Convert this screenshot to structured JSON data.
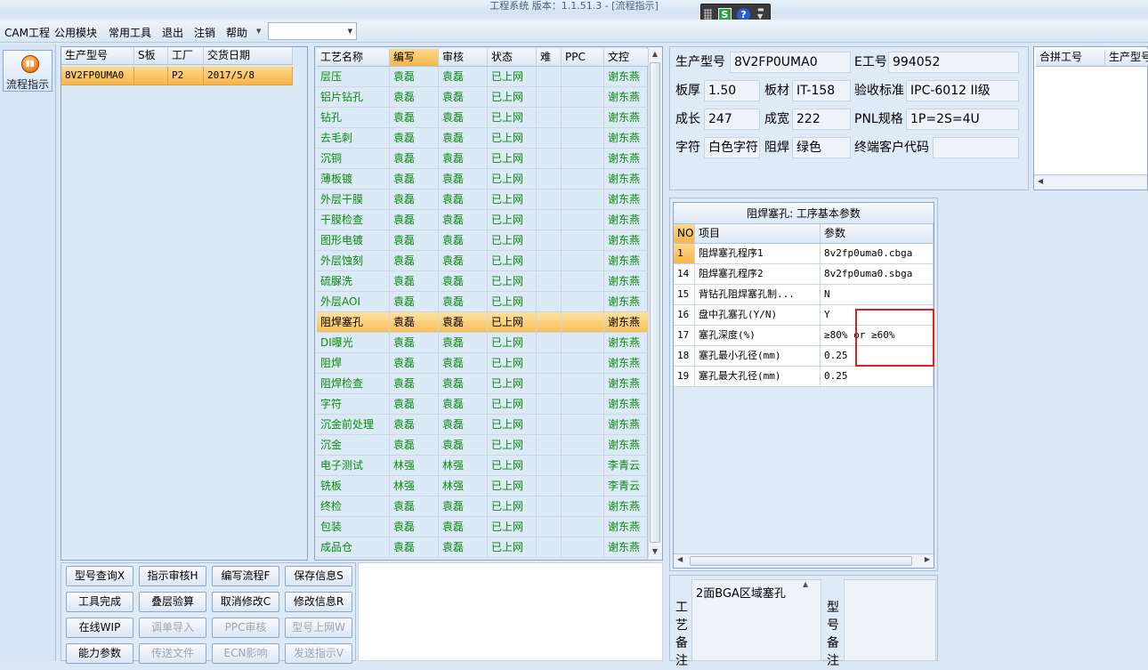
{
  "window": {
    "title": "工程系统   版本：1.1.51.3 - [流程指示]"
  },
  "menu": {
    "items": [
      "CAM工程",
      "公用模块",
      "常用工具",
      "退出",
      "注销",
      "帮助"
    ]
  },
  "left_strip": {
    "flow_button": "流程指示"
  },
  "order_grid": {
    "headers": [
      "生产型号",
      "S板",
      "工厂",
      "交货日期"
    ],
    "row": [
      "8V2FP0UMA0",
      "",
      "P2",
      "2017/5/8"
    ]
  },
  "process_grid": {
    "headers": [
      "工艺名称",
      "编写",
      "审核",
      "状态",
      "难",
      "PPC",
      "文控"
    ],
    "rows": [
      [
        "层压",
        "袁磊",
        "袁磊",
        "已上网",
        "",
        "",
        "谢东燕"
      ],
      [
        "铝片钻孔",
        "袁磊",
        "袁磊",
        "已上网",
        "",
        "",
        "谢东燕"
      ],
      [
        "钻孔",
        "袁磊",
        "袁磊",
        "已上网",
        "",
        "",
        "谢东燕"
      ],
      [
        "去毛刺",
        "袁磊",
        "袁磊",
        "已上网",
        "",
        "",
        "谢东燕"
      ],
      [
        "沉铜",
        "袁磊",
        "袁磊",
        "已上网",
        "",
        "",
        "谢东燕"
      ],
      [
        "薄板镀",
        "袁磊",
        "袁磊",
        "已上网",
        "",
        "",
        "谢东燕"
      ],
      [
        "外层干膜",
        "袁磊",
        "袁磊",
        "已上网",
        "",
        "",
        "谢东燕"
      ],
      [
        "干膜检查",
        "袁磊",
        "袁磊",
        "已上网",
        "",
        "",
        "谢东燕"
      ],
      [
        "图形电镀",
        "袁磊",
        "袁磊",
        "已上网",
        "",
        "",
        "谢东燕"
      ],
      [
        "外层蚀刻",
        "袁磊",
        "袁磊",
        "已上网",
        "",
        "",
        "谢东燕"
      ],
      [
        "硫脲洗",
        "袁磊",
        "袁磊",
        "已上网",
        "",
        "",
        "谢东燕"
      ],
      [
        "外层AOI",
        "袁磊",
        "袁磊",
        "已上网",
        "",
        "",
        "谢东燕"
      ],
      [
        "阻焊塞孔",
        "袁磊",
        "袁磊",
        "已上网",
        "",
        "",
        "谢东燕"
      ],
      [
        "DI曝光",
        "袁磊",
        "袁磊",
        "已上网",
        "",
        "",
        "谢东燕"
      ],
      [
        "阻焊",
        "袁磊",
        "袁磊",
        "已上网",
        "",
        "",
        "谢东燕"
      ],
      [
        "阻焊检查",
        "袁磊",
        "袁磊",
        "已上网",
        "",
        "",
        "谢东燕"
      ],
      [
        "字符",
        "袁磊",
        "袁磊",
        "已上网",
        "",
        "",
        "谢东燕"
      ],
      [
        "沉金前处理",
        "袁磊",
        "袁磊",
        "已上网",
        "",
        "",
        "谢东燕"
      ],
      [
        "沉金",
        "袁磊",
        "袁磊",
        "已上网",
        "",
        "",
        "谢东燕"
      ],
      [
        "电子测试",
        "林强",
        "林强",
        "已上网",
        "",
        "",
        "李青云"
      ],
      [
        "铣板",
        "林强",
        "林强",
        "已上网",
        "",
        "",
        "李青云"
      ],
      [
        "终检",
        "袁磊",
        "袁磊",
        "已上网",
        "",
        "",
        "谢东燕"
      ],
      [
        "包装",
        "袁磊",
        "袁磊",
        "已上网",
        "",
        "",
        "谢东燕"
      ],
      [
        "成品仓",
        "袁磊",
        "袁磊",
        "已上网",
        "",
        "",
        "谢东燕"
      ]
    ],
    "selected_index": 12
  },
  "info": {
    "model_label": "生产型号",
    "model_value": "8V2FP0UMA0",
    "eno_label": "E工号",
    "eno_value": "994052",
    "thickness_label": "板厚",
    "thickness_value": "1.50",
    "material_label": "板材",
    "material_value": "IT-158",
    "standard_label": "验收标准",
    "standard_value": "IPC-6012 II级",
    "length_label": "成长",
    "length_value": "247",
    "width_label": "成宽",
    "width_value": "222",
    "pnl_label": "PNL规格",
    "pnl_value": "1P=2S=4U",
    "char_label": "字符",
    "char_value": "白色字符",
    "mask_label": "阻焊",
    "mask_value": "绿色",
    "customer_label": "终端客户代码",
    "customer_value": ""
  },
  "merge_grid": {
    "headers": [
      "合拼工号",
      "生产型号"
    ]
  },
  "params": {
    "title": "阻焊塞孔: 工序基本参数",
    "headers": [
      "NO",
      "项目",
      "参数"
    ],
    "rows": [
      [
        "1",
        "阻焊塞孔程序1",
        "8v2fp0uma0.cbga"
      ],
      [
        "14",
        "阻焊塞孔程序2",
        "8v2fp0uma0.sbga"
      ],
      [
        "15",
        "背钻孔阻焊塞孔制...",
        "N"
      ],
      [
        "16",
        "盘中孔塞孔(Y/N)",
        "Y"
      ],
      [
        "17",
        "塞孔深度(%)",
        "≥80% or ≥60%"
      ],
      [
        "18",
        "塞孔最小孔径(mm)",
        "0.25"
      ],
      [
        "19",
        "塞孔最大孔径(mm)",
        "0.25"
      ]
    ]
  },
  "buttons": [
    [
      "型号查询X",
      "指示审核H",
      "编写流程F",
      "保存信息S"
    ],
    [
      "工具完成",
      "叠层验算",
      "取消修改C",
      "修改信息R"
    ],
    [
      "在线WIP",
      "调单导入",
      "PPC审核",
      "型号上网W"
    ],
    [
      "能力参数",
      "传送文件",
      "ECN影响",
      "发送指示V"
    ]
  ],
  "disabled_buttons": [
    "调单导入",
    "PPC审核",
    "型号上网W",
    "传送文件",
    "ECN影响",
    "发送指示V"
  ],
  "notes": {
    "process_label": "工艺备注",
    "process_text": "2面BGA区域塞孔",
    "model_label": "型号备注"
  },
  "colors": {
    "accent": "#f5b54a",
    "done_text": "#0a8a0a",
    "highlight": "#e02020"
  }
}
